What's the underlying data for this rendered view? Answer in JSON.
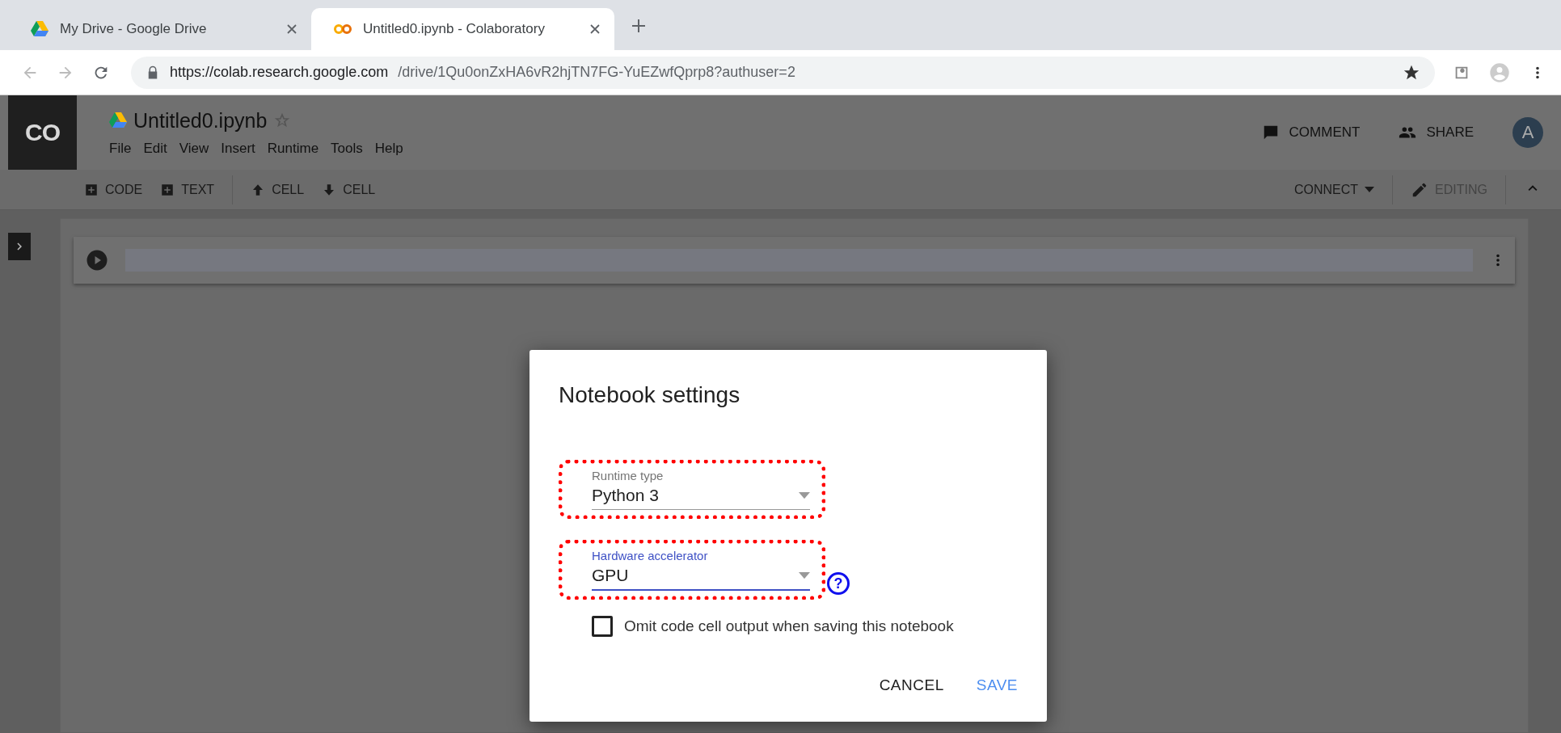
{
  "browser": {
    "tabs": [
      {
        "title": "My Drive - Google Drive",
        "selected": false,
        "kind": "drive"
      },
      {
        "title": "Untitled0.ipynb - Colaboratory",
        "selected": true,
        "kind": "colab"
      }
    ],
    "url_host": "https://colab.research.google.com",
    "url_path": "/drive/1Qu0onZxHA6vR2hjTN7FG-YuEZwfQprp8?authuser=2"
  },
  "app": {
    "logo": "CO",
    "title": "Untitled0.ipynb",
    "menu": [
      "File",
      "Edit",
      "View",
      "Insert",
      "Runtime",
      "Tools",
      "Help"
    ],
    "header_actions": [
      {
        "label": "COMMENT",
        "kind": "comment"
      },
      {
        "label": "SHARE",
        "kind": "share"
      }
    ],
    "avatar": "A",
    "toolbar": [
      {
        "label": "CODE",
        "kind": "add"
      },
      {
        "label": "TEXT",
        "kind": "add"
      },
      {
        "label": "CELL",
        "kind": "up"
      },
      {
        "label": "CELL",
        "kind": "down"
      }
    ],
    "connect": "CONNECT",
    "mode": "EDITING"
  },
  "dialog": {
    "title": "Notebook settings",
    "fields": [
      {
        "label": "Runtime type",
        "value": "Python 3",
        "focused": false,
        "highlighted": true
      },
      {
        "label": "Hardware accelerator",
        "value": "GPU",
        "focused": true,
        "highlighted": true,
        "help": "?"
      }
    ],
    "checkbox": {
      "label": "Omit code cell output when saving this notebook",
      "checked": false
    },
    "buttons": [
      {
        "label": "CANCEL",
        "kind": "neutral"
      },
      {
        "label": "SAVE",
        "kind": "primary"
      }
    ]
  }
}
